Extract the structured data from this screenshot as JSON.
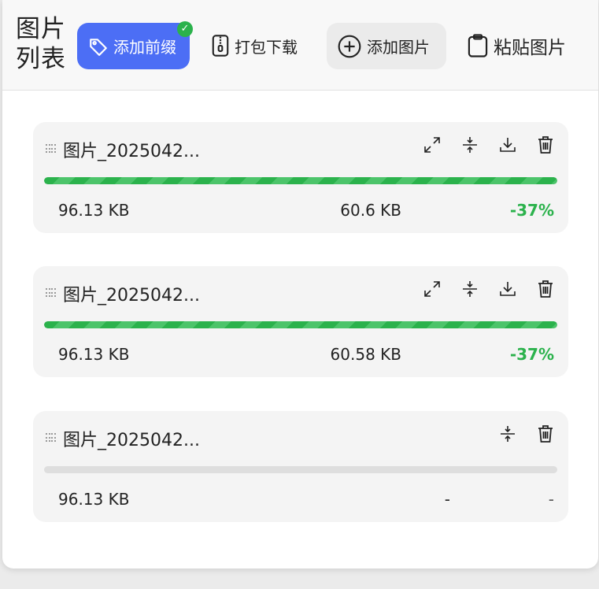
{
  "header": {
    "title": "图片列表",
    "buttons": {
      "add_prefix": "添加前缀",
      "zip_download": "打包下载",
      "add_image": "添加图片",
      "paste_image": "粘贴图片"
    }
  },
  "colors": {
    "accent": "#4c6ef5",
    "success": "#2bb24c",
    "card_bg": "#f4f4f4"
  },
  "images": [
    {
      "name": "图片_2025042...",
      "original_size": "96.13 KB",
      "compressed_size": "60.6 KB",
      "ratio": "-37%",
      "progress": 1.0,
      "actions": [
        "expand-icon",
        "compress-icon",
        "download-icon",
        "trash-icon"
      ]
    },
    {
      "name": "图片_2025042...",
      "original_size": "96.13 KB",
      "compressed_size": "60.58 KB",
      "ratio": "-37%",
      "progress": 1.0,
      "actions": [
        "expand-icon",
        "compress-icon",
        "download-icon",
        "trash-icon"
      ]
    },
    {
      "name": "图片_2025042...",
      "original_size": "96.13 KB",
      "compressed_size": "-",
      "ratio": "-",
      "progress": 0.0,
      "actions": [
        "compress-icon",
        "trash-icon"
      ]
    }
  ]
}
